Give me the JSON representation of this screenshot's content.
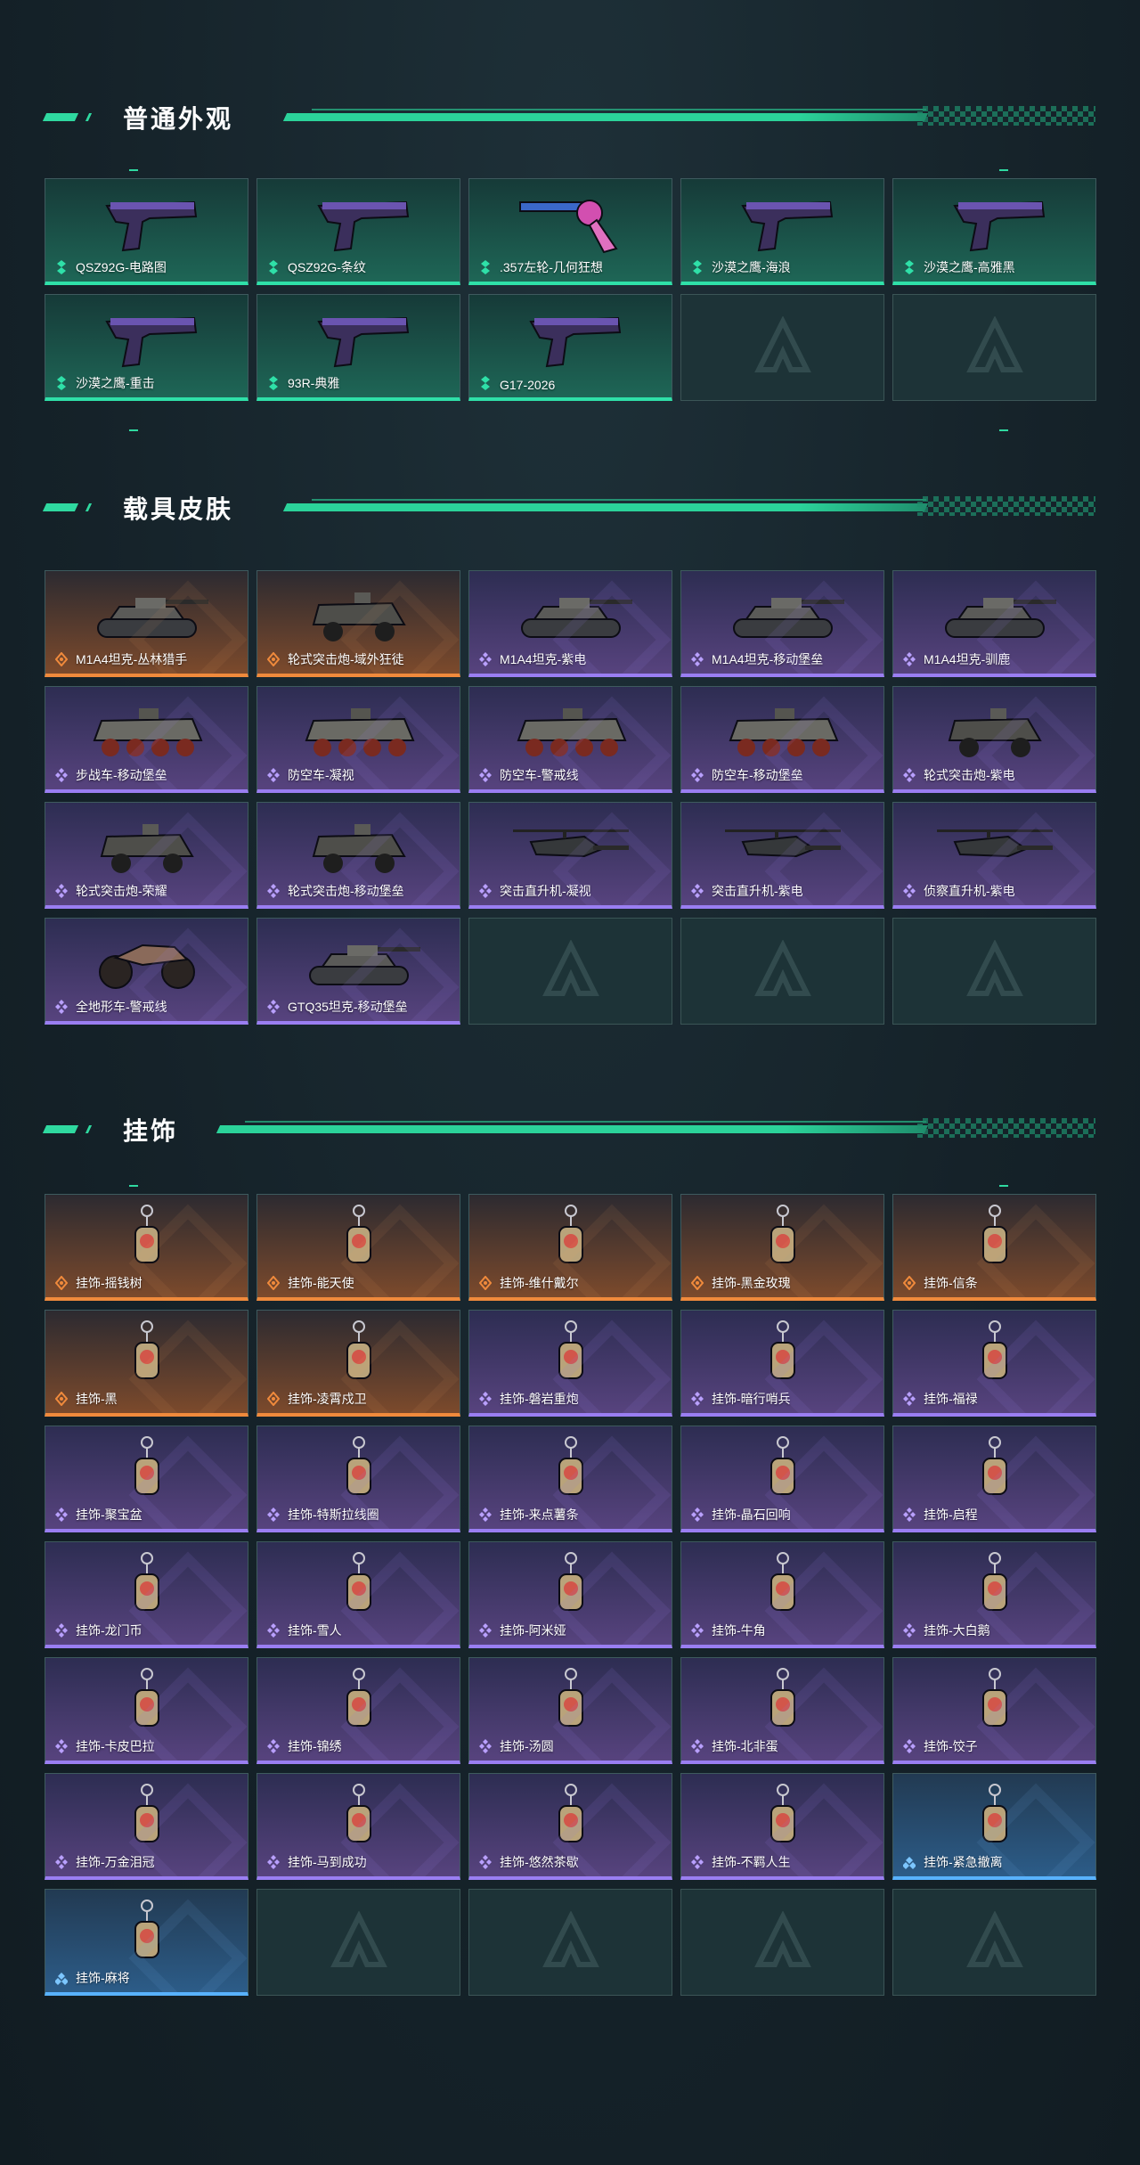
{
  "sections": {
    "weapons": {
      "title": "普通外观",
      "items": [
        {
          "label": "QSZ92G-电路图",
          "rarity": "green",
          "icon": "pistol-icon"
        },
        {
          "label": "QSZ92G-条纹",
          "rarity": "green",
          "icon": "pistol-icon"
        },
        {
          "label": ".357左轮-几何狂想",
          "rarity": "green",
          "icon": "revolver-icon"
        },
        {
          "label": "沙漠之鹰-海浪",
          "rarity": "green",
          "icon": "pistol-icon"
        },
        {
          "label": "沙漠之鹰-高雅黑",
          "rarity": "green",
          "icon": "pistol-icon"
        },
        {
          "label": "沙漠之鹰-重击",
          "rarity": "green",
          "icon": "pistol-icon"
        },
        {
          "label": "93R-典雅",
          "rarity": "green",
          "icon": "pistol-icon"
        },
        {
          "label": "G17-2026",
          "rarity": "green",
          "icon": "pistol-icon"
        }
      ]
    },
    "vehicles": {
      "title": "载具皮肤",
      "items": [
        {
          "label": "M1A4坦克-丛林猎手",
          "rarity": "orange",
          "icon": "tank-icon"
        },
        {
          "label": "轮式突击炮-域外狂徒",
          "rarity": "orange",
          "icon": "armored-car-icon"
        },
        {
          "label": "M1A4坦克-紫电",
          "rarity": "purple",
          "icon": "tank-icon"
        },
        {
          "label": "M1A4坦克-移动堡垒",
          "rarity": "purple",
          "icon": "tank-icon"
        },
        {
          "label": "M1A4坦克-驯鹿",
          "rarity": "purple",
          "icon": "tank-icon"
        },
        {
          "label": "步战车-移动堡垒",
          "rarity": "purple",
          "icon": "ifv-icon"
        },
        {
          "label": "防空车-凝视",
          "rarity": "purple",
          "icon": "ifv-icon"
        },
        {
          "label": "防空车-警戒线",
          "rarity": "purple",
          "icon": "ifv-icon"
        },
        {
          "label": "防空车-移动堡垒",
          "rarity": "purple",
          "icon": "ifv-icon"
        },
        {
          "label": "轮式突击炮-紫电",
          "rarity": "purple",
          "icon": "armored-car-icon"
        },
        {
          "label": "轮式突击炮-荣耀",
          "rarity": "purple",
          "icon": "armored-car-icon"
        },
        {
          "label": "轮式突击炮-移动堡垒",
          "rarity": "purple",
          "icon": "armored-car-icon"
        },
        {
          "label": "突击直升机-凝视",
          "rarity": "purple",
          "icon": "helicopter-icon"
        },
        {
          "label": "突击直升机-紫电",
          "rarity": "purple",
          "icon": "helicopter-icon"
        },
        {
          "label": "侦察直升机-紫电",
          "rarity": "purple",
          "icon": "helicopter-icon"
        },
        {
          "label": "全地形车-警戒线",
          "rarity": "purple",
          "icon": "atv-icon"
        },
        {
          "label": "GTQ35坦克-移动堡垒",
          "rarity": "purple",
          "icon": "tank-icon"
        }
      ]
    },
    "charms": {
      "title": "挂饰",
      "items": [
        {
          "label": "挂饰-摇钱树",
          "rarity": "orange",
          "icon": "charm-icon"
        },
        {
          "label": "挂饰-能天使",
          "rarity": "orange",
          "icon": "charm-icon"
        },
        {
          "label": "挂饰-维什戴尔",
          "rarity": "orange",
          "icon": "charm-icon"
        },
        {
          "label": "挂饰-黑金玫瑰",
          "rarity": "orange",
          "icon": "charm-icon"
        },
        {
          "label": "挂饰-信条",
          "rarity": "orange",
          "icon": "charm-icon"
        },
        {
          "label": "挂饰-黑",
          "rarity": "orange",
          "icon": "charm-icon"
        },
        {
          "label": "挂饰-凌霄戍卫",
          "rarity": "orange",
          "icon": "charm-icon"
        },
        {
          "label": "挂饰-磐岩重炮",
          "rarity": "purple",
          "icon": "charm-icon"
        },
        {
          "label": "挂饰-暗行哨兵",
          "rarity": "purple",
          "icon": "charm-icon"
        },
        {
          "label": "挂饰-福禄",
          "rarity": "purple",
          "icon": "charm-icon"
        },
        {
          "label": "挂饰-聚宝盆",
          "rarity": "purple",
          "icon": "charm-icon"
        },
        {
          "label": "挂饰-特斯拉线圈",
          "rarity": "purple",
          "icon": "charm-icon"
        },
        {
          "label": "挂饰-来点薯条",
          "rarity": "purple",
          "icon": "charm-icon"
        },
        {
          "label": "挂饰-晶石回响",
          "rarity": "purple",
          "icon": "charm-icon"
        },
        {
          "label": "挂饰-启程",
          "rarity": "purple",
          "icon": "charm-icon"
        },
        {
          "label": "挂饰-龙门币",
          "rarity": "purple",
          "icon": "charm-icon"
        },
        {
          "label": "挂饰-雪人",
          "rarity": "purple",
          "icon": "charm-icon"
        },
        {
          "label": "挂饰-阿米娅",
          "rarity": "purple",
          "icon": "charm-icon"
        },
        {
          "label": "挂饰-牛角",
          "rarity": "purple",
          "icon": "charm-icon"
        },
        {
          "label": "挂饰-大白鹅",
          "rarity": "purple",
          "icon": "charm-icon"
        },
        {
          "label": "挂饰-卡皮巴拉",
          "rarity": "purple",
          "icon": "charm-icon"
        },
        {
          "label": "挂饰-锦绣",
          "rarity": "purple",
          "icon": "charm-icon"
        },
        {
          "label": "挂饰-汤圆",
          "rarity": "purple",
          "icon": "charm-icon"
        },
        {
          "label": "挂饰-北非蛋",
          "rarity": "purple",
          "icon": "charm-icon"
        },
        {
          "label": "挂饰-饺子",
          "rarity": "purple",
          "icon": "charm-icon"
        },
        {
          "label": "挂饰-万金泪冠",
          "rarity": "purple",
          "icon": "charm-icon"
        },
        {
          "label": "挂饰-马到成功",
          "rarity": "purple",
          "icon": "charm-icon"
        },
        {
          "label": "挂饰-悠然茶歇",
          "rarity": "purple",
          "icon": "charm-icon"
        },
        {
          "label": "挂饰-不羁人生",
          "rarity": "purple",
          "icon": "charm-icon"
        },
        {
          "label": "挂饰-紧急撤离",
          "rarity": "blue",
          "icon": "charm-icon"
        },
        {
          "label": "挂饰-麻将",
          "rarity": "blue",
          "icon": "charm-icon"
        }
      ]
    }
  },
  "colors": {
    "accent": "#2fd9a0",
    "green": "#2fe0a8",
    "orange": "#f08a3c",
    "purple": "#9a7ef2",
    "blue": "#58b2ff"
  }
}
